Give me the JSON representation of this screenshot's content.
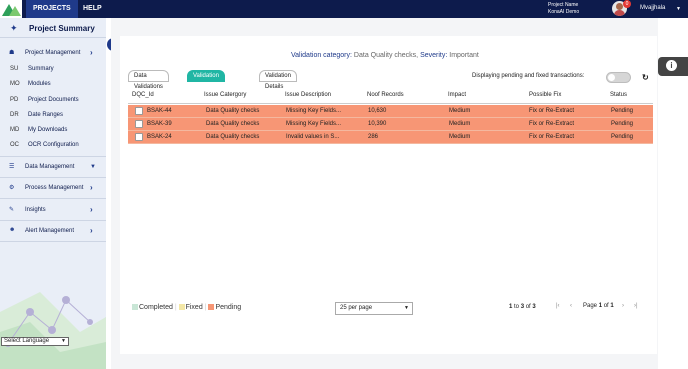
{
  "topbar": {
    "tabs": [
      "PROJECTS",
      "HELP"
    ],
    "project_name_label": "Project Name",
    "project_name": "KonaAI Demo",
    "notification_count": "0",
    "username": "Mvajjhala"
  },
  "sidebar": {
    "title": "Project Summary",
    "project_management": "Project Management",
    "sub_items": [
      {
        "code": "SU",
        "label": "Summary"
      },
      {
        "code": "MO",
        "label": "Modules"
      },
      {
        "code": "PD",
        "label": "Project Documents"
      },
      {
        "code": "DR",
        "label": "Date Ranges"
      },
      {
        "code": "MD",
        "label": "My Downloads"
      },
      {
        "code": "OC",
        "label": "OCR Configuration"
      }
    ],
    "sections": [
      {
        "label": "Data Management"
      },
      {
        "label": "Process Management"
      },
      {
        "label": "Insights"
      },
      {
        "label": "Alert Management"
      }
    ],
    "language_select": "Select Language"
  },
  "header": {
    "category_label": "Validation category:",
    "category_value": "Data Quality checks,",
    "severity_label": "Severity:",
    "severity_value": "Important"
  },
  "tabs": [
    "Data Validations",
    "Validation Summary",
    "Validation Details"
  ],
  "toggle_label": "Displaying pending and fixed transactions:",
  "table": {
    "columns": [
      "DQC_Id",
      "Issue Catergory",
      "Issue Description",
      "Noof Records",
      "Impact",
      "Possible Fix",
      "Status"
    ],
    "rows": [
      {
        "id": "BSAK-44",
        "category": "Data Quality checks",
        "description": "Missing Key Fields...",
        "records": "10,630",
        "impact": "Medium",
        "fix": "Fix or Re-Extract",
        "status": "Pending"
      },
      {
        "id": "BSAK-39",
        "category": "Data Quality checks",
        "description": "Missing Key Fields...",
        "records": "10,390",
        "impact": "Medium",
        "fix": "Fix or Re-Extract",
        "status": "Pending"
      },
      {
        "id": "BSAK-24",
        "category": "Data Quality checks",
        "description": "Invalid values in S...",
        "records": "286",
        "impact": "Medium",
        "fix": "Fix or Re-Extract",
        "status": "Pending"
      }
    ]
  },
  "footer": {
    "legend": [
      {
        "label": "Completed",
        "color": "#c9e6d6"
      },
      {
        "label": "Fixed",
        "color": "#f3e7a6"
      },
      {
        "label": "Pending",
        "color": "#f79675"
      }
    ],
    "per_page": "25 per page",
    "range_from": "1",
    "range_to": "3",
    "range_of": "3",
    "range_to_word": "to",
    "range_of_word": "of",
    "page_word": "Page",
    "page_current": "1",
    "page_total": "1"
  },
  "colors": {
    "topbar": "#0d1b4c",
    "accent_tab": "#20b6a4",
    "pending_row": "#f79675"
  }
}
